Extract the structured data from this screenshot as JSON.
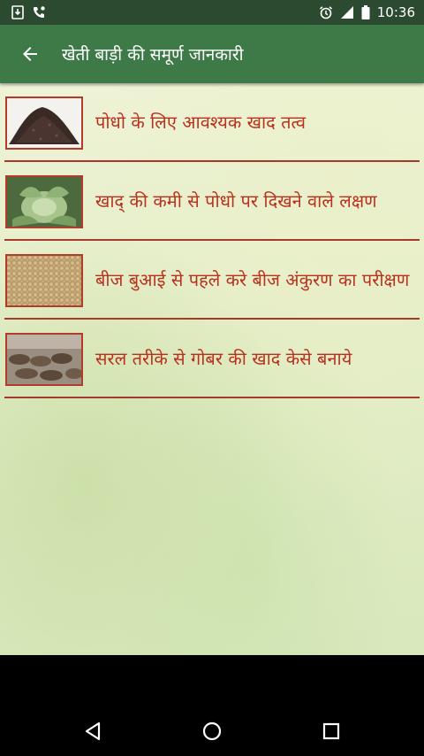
{
  "status_bar": {
    "time": "10:36",
    "icons": [
      "download-icon",
      "phone-icon",
      "alarm-icon",
      "signal-icon",
      "battery-icon"
    ]
  },
  "app_bar": {
    "back_icon": "arrow-back-icon",
    "title": "खेती बाड़ी की समूर्ण जानकारी"
  },
  "items": [
    {
      "label": "पोधो के लिए आवश्यक खाद तत्व",
      "thumb": "soil-image"
    },
    {
      "label": "खाद् की कमी से पोधो पर दिखने वाले लक्षण",
      "thumb": "cabbage-image"
    },
    {
      "label": "बीज बुआई से पहले करे बीज अंकुरण का परीक्षण",
      "thumb": "seeds-image"
    },
    {
      "label": "सरल तरीके से गोबर की खाद केसे बनाये",
      "thumb": "dung-cakes-image"
    }
  ],
  "nav_bar": {
    "buttons": [
      "back-triangle-icon",
      "home-circle-icon",
      "recents-square-icon"
    ]
  },
  "colors": {
    "status_bar": "#2b4a2f",
    "app_bar": "#3d7a47",
    "item_text": "#b8321f",
    "divider": "#a33a2b"
  }
}
